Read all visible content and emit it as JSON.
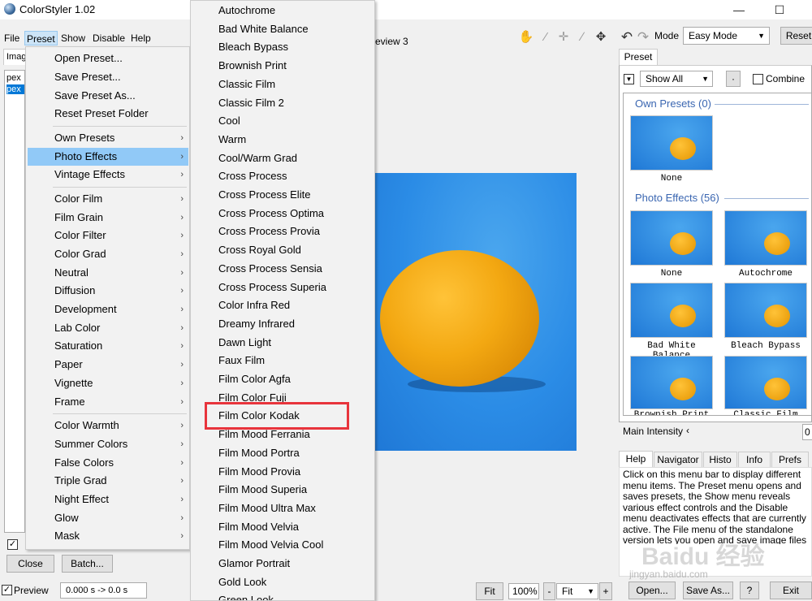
{
  "window": {
    "title": "ColorStyler 1.02",
    "minimize": "—",
    "maximize": "☐"
  },
  "menubar": {
    "file": "File",
    "preset": "Preset",
    "show": "Show",
    "disable": "Disable",
    "help": "Help"
  },
  "left": {
    "tab": "Imag",
    "files": [
      "pex",
      "pex"
    ],
    "checkbox_mark": "✓",
    "close": "Close",
    "batch": "Batch...",
    "preview_label": "Preview",
    "timing": "0.000 s -> 0.0 s"
  },
  "preset_menu": {
    "items": [
      {
        "label": "Open Preset..."
      },
      {
        "label": "Save Preset..."
      },
      {
        "label": "Save Preset As..."
      },
      {
        "label": "Reset Preset Folder"
      },
      {
        "label": "Own Presets"
      },
      {
        "label": "Photo Effects"
      },
      {
        "label": "Vintage Effects"
      },
      {
        "label": "Color Film"
      },
      {
        "label": "Film Grain"
      },
      {
        "label": "Color Filter"
      },
      {
        "label": "Color Grad"
      },
      {
        "label": "Neutral"
      },
      {
        "label": "Diffusion"
      },
      {
        "label": "Development"
      },
      {
        "label": "Lab Color"
      },
      {
        "label": "Saturation"
      },
      {
        "label": "Paper"
      },
      {
        "label": "Vignette"
      },
      {
        "label": "Frame"
      },
      {
        "label": "Color Warmth"
      },
      {
        "label": "Summer Colors"
      },
      {
        "label": "False Colors"
      },
      {
        "label": "Triple Grad"
      },
      {
        "label": "Night Effect"
      },
      {
        "label": "Glow"
      },
      {
        "label": "Mask"
      }
    ],
    "arrow": "›"
  },
  "photo_effects": [
    "Autochrome",
    "Bad White Balance",
    "Bleach Bypass",
    "Brownish Print",
    "Classic Film",
    "Classic Film 2",
    "Cool",
    "Warm",
    "Cool/Warm Grad",
    "Cross Process",
    "Cross Process Elite",
    "Cross Process Optima",
    "Cross Process Provia",
    "Cross Royal Gold",
    "Cross Process Sensia",
    "Cross Process Superia",
    "Color Infra Red",
    "Dreamy Infrared",
    "Dawn Light",
    "Faux Film",
    "Film Color Agfa",
    "Film Color Fuji",
    "Film Color Kodak",
    "Film Mood Ferrania",
    "Film Mood Portra",
    "Film Mood Provia",
    "Film Mood Superia",
    "Film Mood Ultra Max",
    "Film Mood Velvia",
    "Film Mood Velvia Cool",
    "Glamor Portrait",
    "Gold Look",
    "Green Look"
  ],
  "center": {
    "tab_label": "eview 3",
    "tools": {
      "hand": "✋",
      "eyedropper": "⁄",
      "crosshair": "✛",
      "brush": "∕",
      "move": "✥"
    },
    "zoom_fit": "Fit",
    "zoom_value": "100%",
    "zoom_minus": "-",
    "zoom_select": "Fit",
    "zoom_plus": "+"
  },
  "toolbar_right": {
    "undo": "↶",
    "redo": "↷",
    "mode_label": "Mode",
    "mode_value": "Easy Mode",
    "reset": "Reset"
  },
  "preset_panel": {
    "tab": "Preset",
    "filter": "Show All",
    "dot_button": "·",
    "combine_label": "Combine",
    "own_presets_title": "Own Presets (0)",
    "photo_effects_title": "Photo Effects (56)",
    "own_thumbs": [
      "None"
    ],
    "effect_thumbs": [
      "None",
      "Autochrome",
      "Bad White Balance",
      "Bleach Bypass",
      "Brownish Print",
      "Classic Film"
    ],
    "intensity_label": "Main Intensity",
    "intensity_value": "0"
  },
  "help_panel": {
    "tabs": [
      "Help",
      "Navigator",
      "Histo",
      "Info",
      "Prefs"
    ],
    "text": "Click on this menu bar to display different menu items. The Preset menu opens and saves presets, the Show menu reveals various effect controls and the Disable menu deactivates effects that are currently active. The File menu of the standalone version lets you open and save image files among other things."
  },
  "bottom_right": {
    "open": "Open...",
    "save_as": "Save As...",
    "help": "?",
    "exit": "Exit"
  },
  "watermark": {
    "brand": "Baidu 经验",
    "url": "jingyan.baidu.com"
  }
}
